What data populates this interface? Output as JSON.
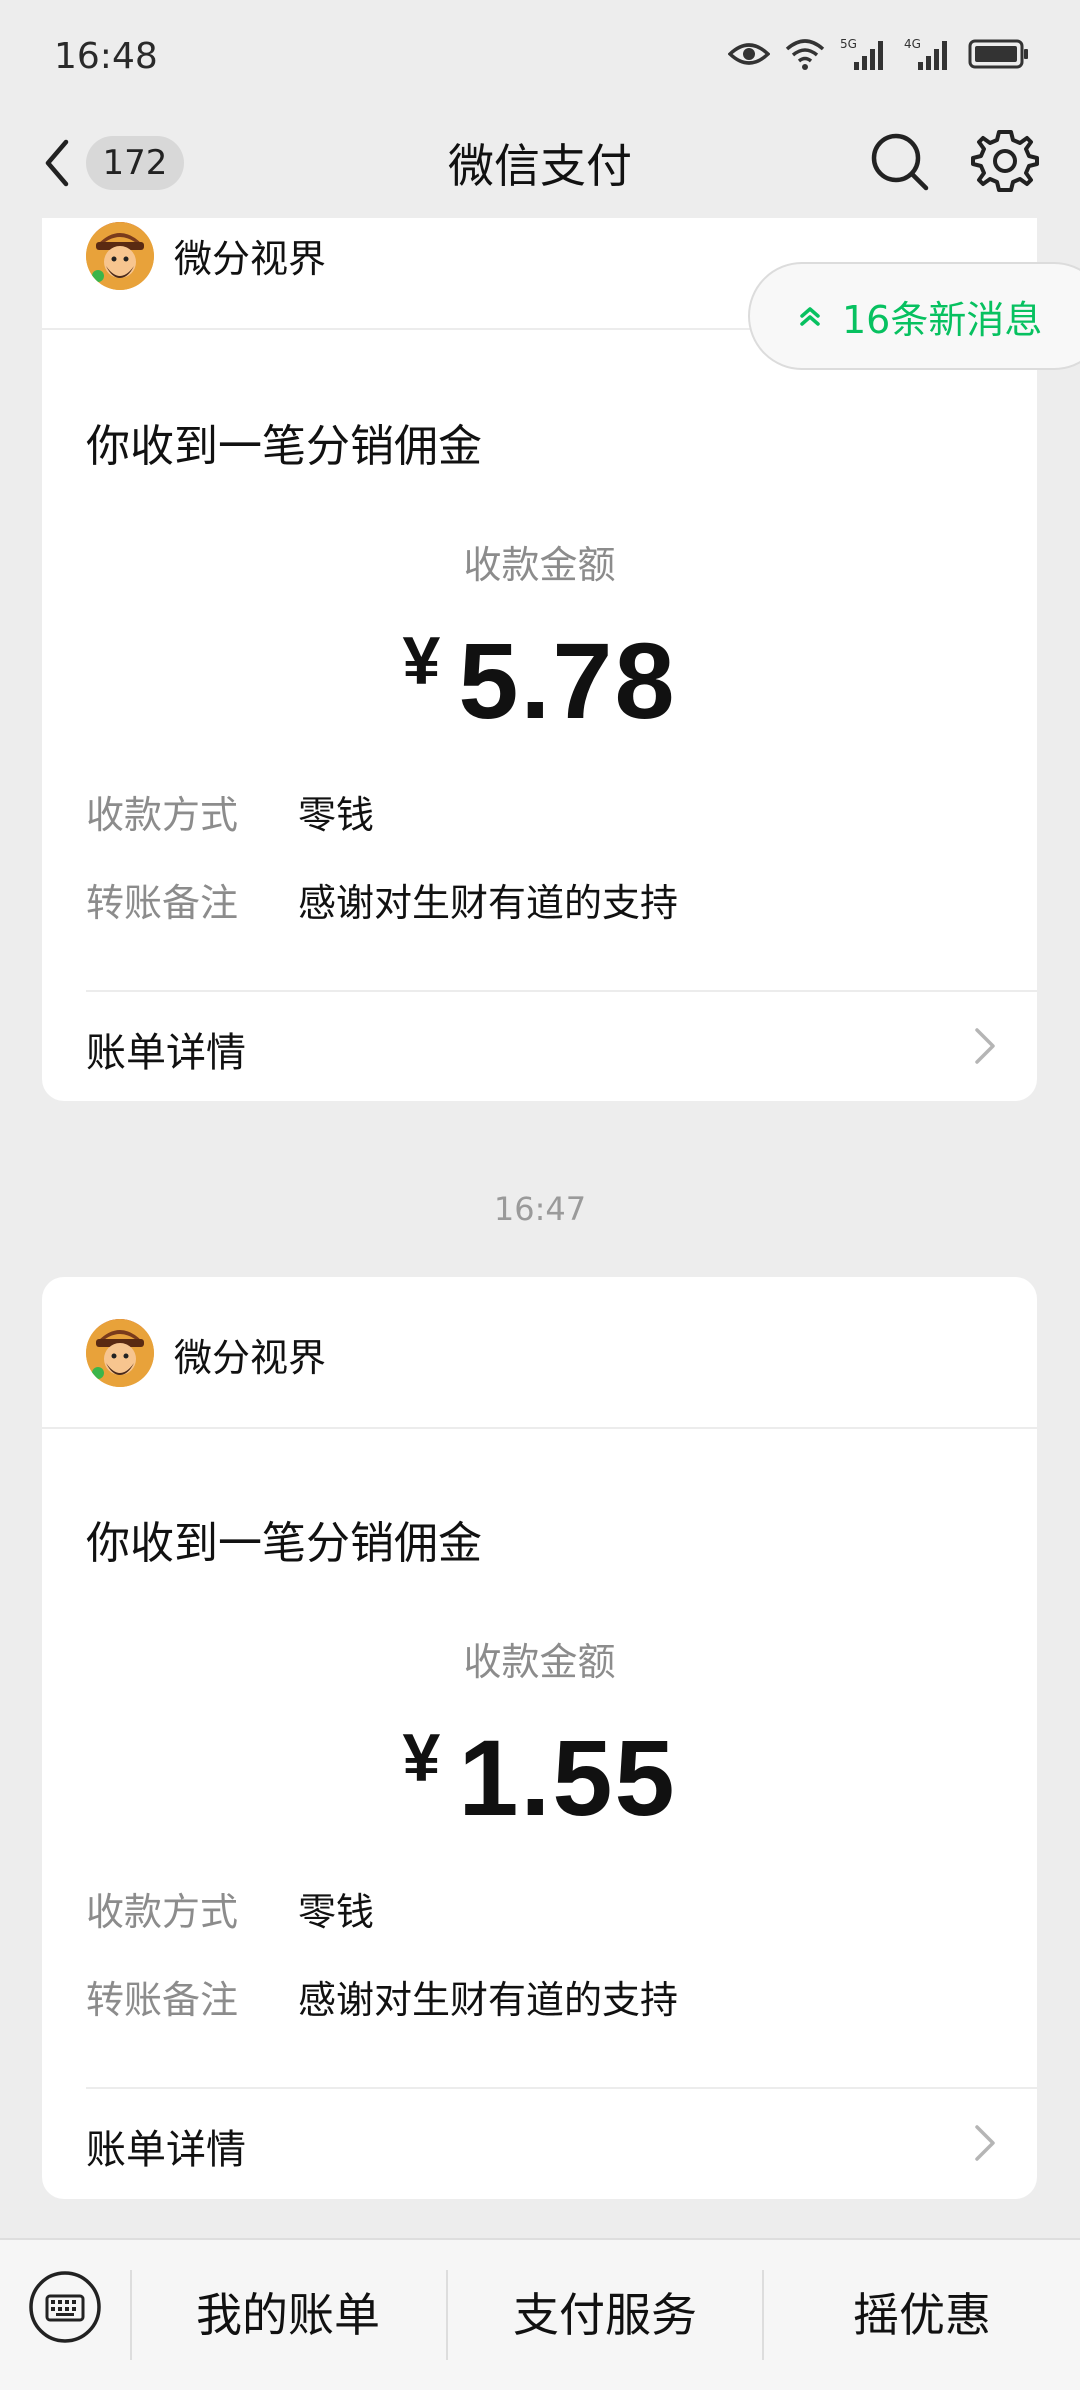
{
  "status_bar": {
    "time": "16:48",
    "network_labels": [
      "5G",
      "4G"
    ],
    "icons": [
      "eye-icon",
      "wifi-icon",
      "signal-5g-icon",
      "signal-4g-icon",
      "battery-icon"
    ]
  },
  "nav": {
    "back_count": "172",
    "title": "微信支付",
    "icons": [
      "back-chevron-icon",
      "search-icon",
      "gear-icon"
    ]
  },
  "new_messages": {
    "label": "16条新消息",
    "icon": "double-chevron-up-icon"
  },
  "messages": [
    {
      "sender": "微分视界",
      "title": "你收到一笔分销佣金",
      "amount_label": "收款金额",
      "currency": "¥",
      "amount": "5.78",
      "rows": [
        {
          "label": "收款方式",
          "value": "零钱"
        },
        {
          "label": "转账备注",
          "value": "感谢对生财有道的支持"
        }
      ],
      "detail_label": "账单详情"
    },
    {
      "sender": "微分视界",
      "title": "你收到一笔分销佣金",
      "amount_label": "收款金额",
      "currency": "¥",
      "amount": "1.55",
      "rows": [
        {
          "label": "收款方式",
          "value": "零钱"
        },
        {
          "label": "转账备注",
          "value": "感谢对生财有道的支持"
        }
      ],
      "detail_label": "账单详情"
    }
  ],
  "timestamp": "16:47",
  "bottom_menu": {
    "keyboard_icon": "keyboard-icon",
    "items": [
      "我的账单",
      "支付服务",
      "摇优惠"
    ]
  },
  "colors": {
    "accent_green": "#07c160",
    "background": "#ededed",
    "card": "#ffffff"
  }
}
